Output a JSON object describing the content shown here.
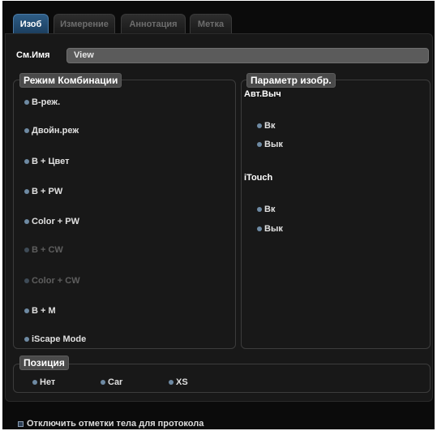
{
  "tabs": [
    {
      "label": "Изоб",
      "active": true
    },
    {
      "label": "Измерение",
      "active": false
    },
    {
      "label": "Аннотация",
      "active": false
    },
    {
      "label": "Метка",
      "active": false
    }
  ],
  "name_field": {
    "label": "См.Имя",
    "value": "View"
  },
  "combo_mode": {
    "title": "Режим Комбинации",
    "options": [
      {
        "label": "B-реж.",
        "enabled": true
      },
      {
        "label": "Двойн.реж",
        "enabled": true
      },
      {
        "label": "B + Цвет",
        "enabled": true
      },
      {
        "label": "B + PW",
        "enabled": true
      },
      {
        "label": "Color + PW",
        "enabled": true
      },
      {
        "label": "B + CW",
        "enabled": false
      },
      {
        "label": "Color + CW",
        "enabled": false
      },
      {
        "label": "B + M",
        "enabled": true
      },
      {
        "label": "iScape Mode",
        "enabled": true
      }
    ]
  },
  "image_params": {
    "title": "Параметр изобр.",
    "auto_calc": {
      "label": "Авт.Выч",
      "on": "Вк",
      "off": "Вык"
    },
    "itouch": {
      "label": "iTouch",
      "on": "Вк",
      "off": "Вык"
    }
  },
  "position": {
    "title": "Позиция",
    "options": [
      "Нет",
      "Car",
      "XS"
    ]
  },
  "protocol_checkbox": {
    "label": "Отключить отметки тела для протокола",
    "checked": true
  },
  "colors": {
    "active_tab": "#2e5d86",
    "radio_dot": "#6e8aa3"
  }
}
